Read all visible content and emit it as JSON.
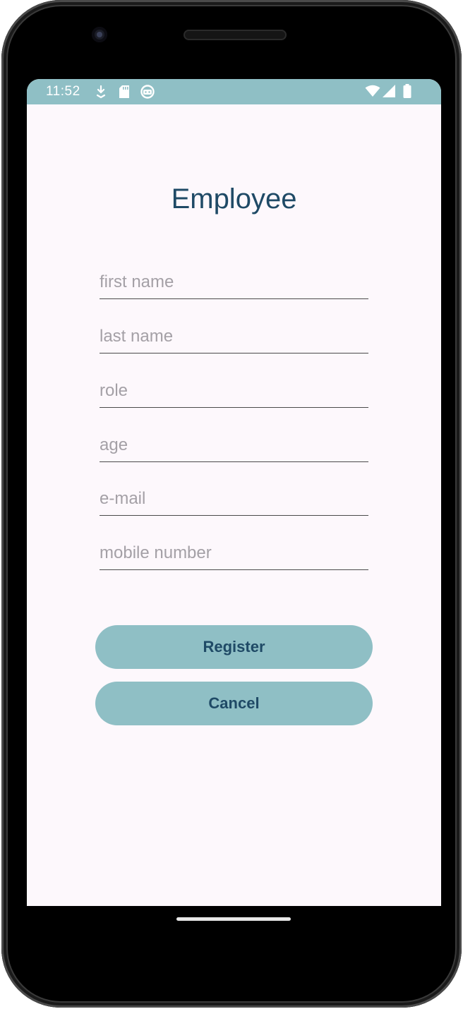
{
  "status_bar": {
    "time": "11:52",
    "left_icons": [
      "download-arrow-icon",
      "sd-card-icon",
      "android-face-icon"
    ],
    "right_icons": [
      "wifi-icon",
      "cellular-signal-icon",
      "battery-icon"
    ],
    "background_color": "#8fbfc5"
  },
  "form": {
    "title": "Employee",
    "fields": [
      {
        "name": "first-name",
        "placeholder": "first name",
        "value": ""
      },
      {
        "name": "last-name",
        "placeholder": "last name",
        "value": ""
      },
      {
        "name": "role",
        "placeholder": "role",
        "value": ""
      },
      {
        "name": "age",
        "placeholder": "age",
        "value": ""
      },
      {
        "name": "email",
        "placeholder": "e-mail",
        "value": ""
      },
      {
        "name": "mobile-number",
        "placeholder": "mobile number",
        "value": ""
      }
    ],
    "register_label": "Register",
    "cancel_label": "Cancel"
  },
  "colors": {
    "accent": "#8fbfc5",
    "title_text": "#1f4a66",
    "screen_background": "#fdf8fc",
    "placeholder_text": "#a4a0a6"
  }
}
